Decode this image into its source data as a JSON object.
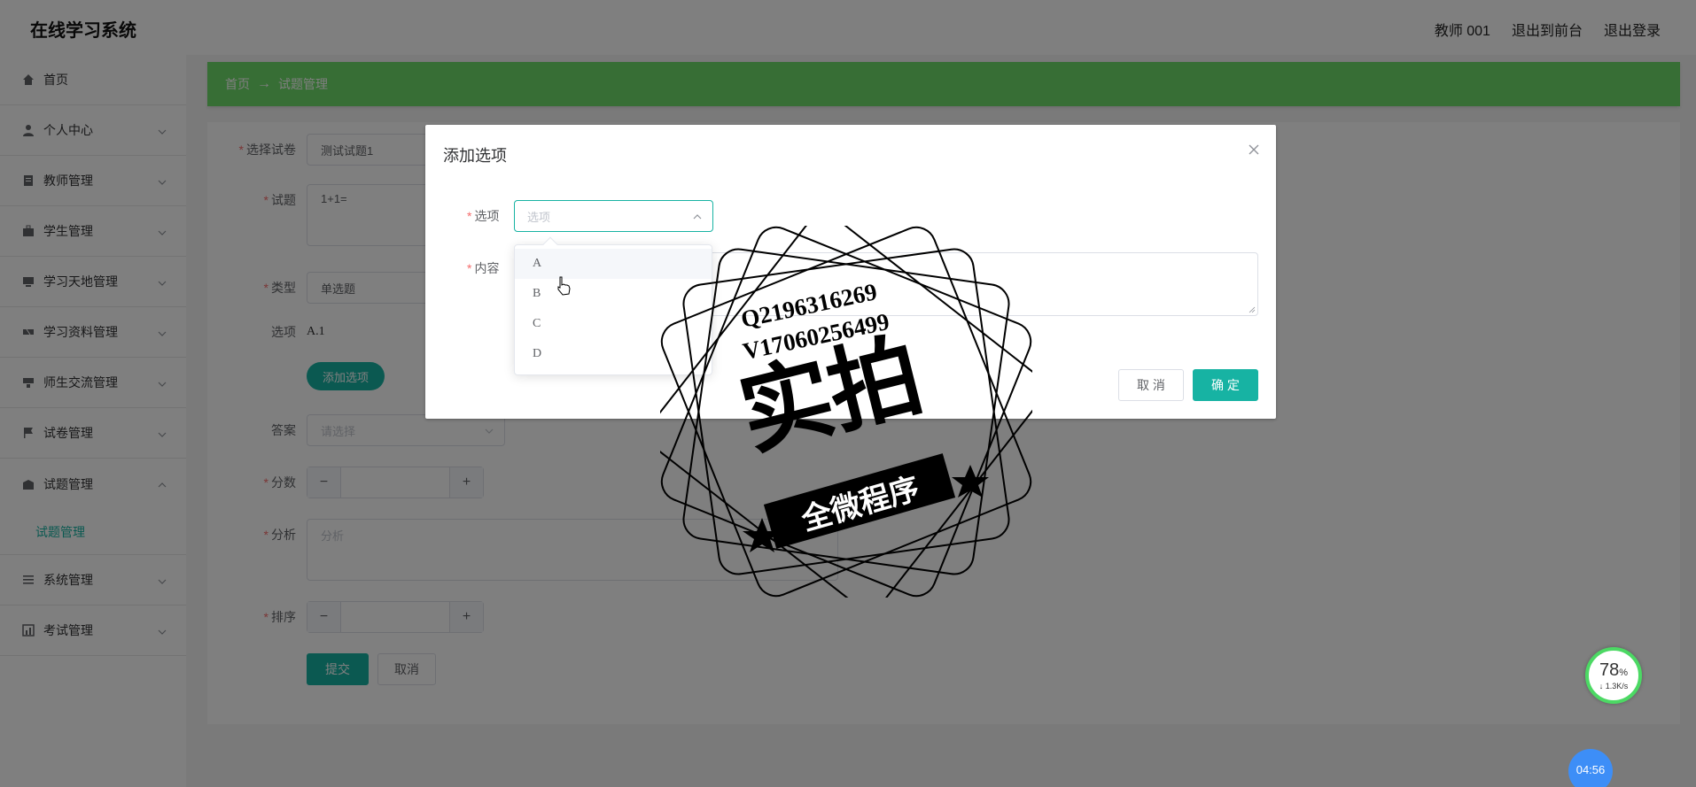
{
  "app": {
    "title": "在线学习系统"
  },
  "top_links": {
    "user": "教师 001",
    "front": "退出到前台",
    "logout": "退出登录"
  },
  "sidebar": {
    "items": [
      {
        "label": "首页",
        "icon": "home-icon"
      },
      {
        "label": "个人中心",
        "icon": "user-icon"
      },
      {
        "label": "教师管理",
        "icon": "doc-icon"
      },
      {
        "label": "学生管理",
        "icon": "briefcase-icon"
      },
      {
        "label": "学习天地管理",
        "icon": "monitor-icon"
      },
      {
        "label": "学习资料管理",
        "icon": "ticket-icon"
      },
      {
        "label": "师生交流管理",
        "icon": "chat-icon"
      },
      {
        "label": "试卷管理",
        "icon": "flag-icon"
      },
      {
        "label": "试题管理",
        "icon": "home-icon"
      },
      {
        "label": "系统管理",
        "icon": "list-icon"
      },
      {
        "label": "考试管理",
        "icon": "chart-icon"
      }
    ],
    "sub_item": "试题管理"
  },
  "breadcrumb": {
    "home": "首页",
    "sep": "→",
    "current": "试题管理"
  },
  "form": {
    "paper_label": "选择试卷",
    "paper_value": "测试试题1",
    "question_label": "试题",
    "question_value": "1+1=",
    "type_label": "类型",
    "type_value": "单选题",
    "options_label": "选项",
    "options_value": "A.1",
    "add_option_btn": "添加选项",
    "answer_label": "答案",
    "answer_placeholder": "请选择",
    "score_label": "分数",
    "analysis_label": "分析",
    "analysis_placeholder": "分析",
    "order_label": "排序",
    "submit_btn": "提交",
    "cancel_btn": "取消"
  },
  "dialog": {
    "title": "添加选项",
    "option_label": "选项",
    "option_placeholder": "选项",
    "content_label": "内容",
    "cancel": "取 消",
    "ok": "确 定",
    "dropdown": [
      "A",
      "B",
      "C",
      "D"
    ]
  },
  "watermark": {
    "phone1": "Q2196316269",
    "phone2": "V17060256499",
    "big": "实拍",
    "band": "全微程序"
  },
  "widgets": {
    "speed_pct": "78",
    "speed_unit": "%",
    "speed_rate": "↓ 1.3K/s",
    "timer": "04:56"
  },
  "colors": {
    "accent": "#17b3a3",
    "breadcrumb": "#6fdc6a",
    "required": "#f56c6c"
  }
}
